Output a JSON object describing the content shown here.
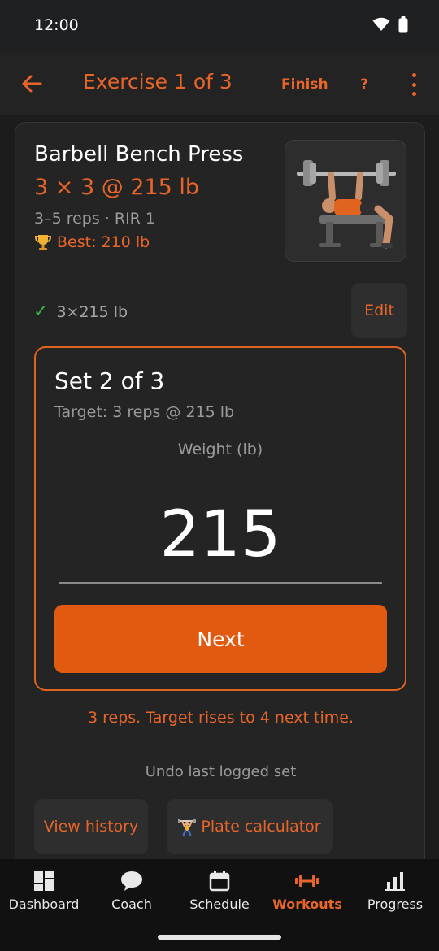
{
  "status_bar": {
    "time": "12:00"
  },
  "app_bar": {
    "title": "Exercise 1 of 3",
    "finish_label": "Finish",
    "help_label": "?"
  },
  "exercise": {
    "name": "Barbell Bench Press",
    "scheme": "3 × 3 @ 215 lb",
    "rep_range": "3–5 reps · RIR 1",
    "best": "Best: 210 lb",
    "logged_set": "3×215 lb",
    "edit_label": "Edit"
  },
  "set_entry": {
    "title": "Set 2 of 3",
    "target": "Target: 3 reps @ 215 lb",
    "weight_label": "Weight (lb)",
    "weight_value": "215",
    "next_label": "Next"
  },
  "feedback": "3 reps. Target rises to 4 next time.",
  "undo_label": "Undo last logged set",
  "actions": {
    "history_label": "View history",
    "plate_label": "Plate calculator"
  },
  "bottom_nav": {
    "items": [
      {
        "label": "Dashboard",
        "icon": "dashboard-icon"
      },
      {
        "label": "Coach",
        "icon": "chat-bubble-icon"
      },
      {
        "label": "Schedule",
        "icon": "calendar-icon"
      },
      {
        "label": "Workouts",
        "icon": "dumbbell-icon"
      },
      {
        "label": "Progress",
        "icon": "bar-chart-icon"
      }
    ],
    "active": "Workouts"
  },
  "colors": {
    "accent": "#e8652a",
    "button": "#e25a10",
    "success": "#3fae4c",
    "background": "#1c1c1c",
    "card": "#242424"
  }
}
